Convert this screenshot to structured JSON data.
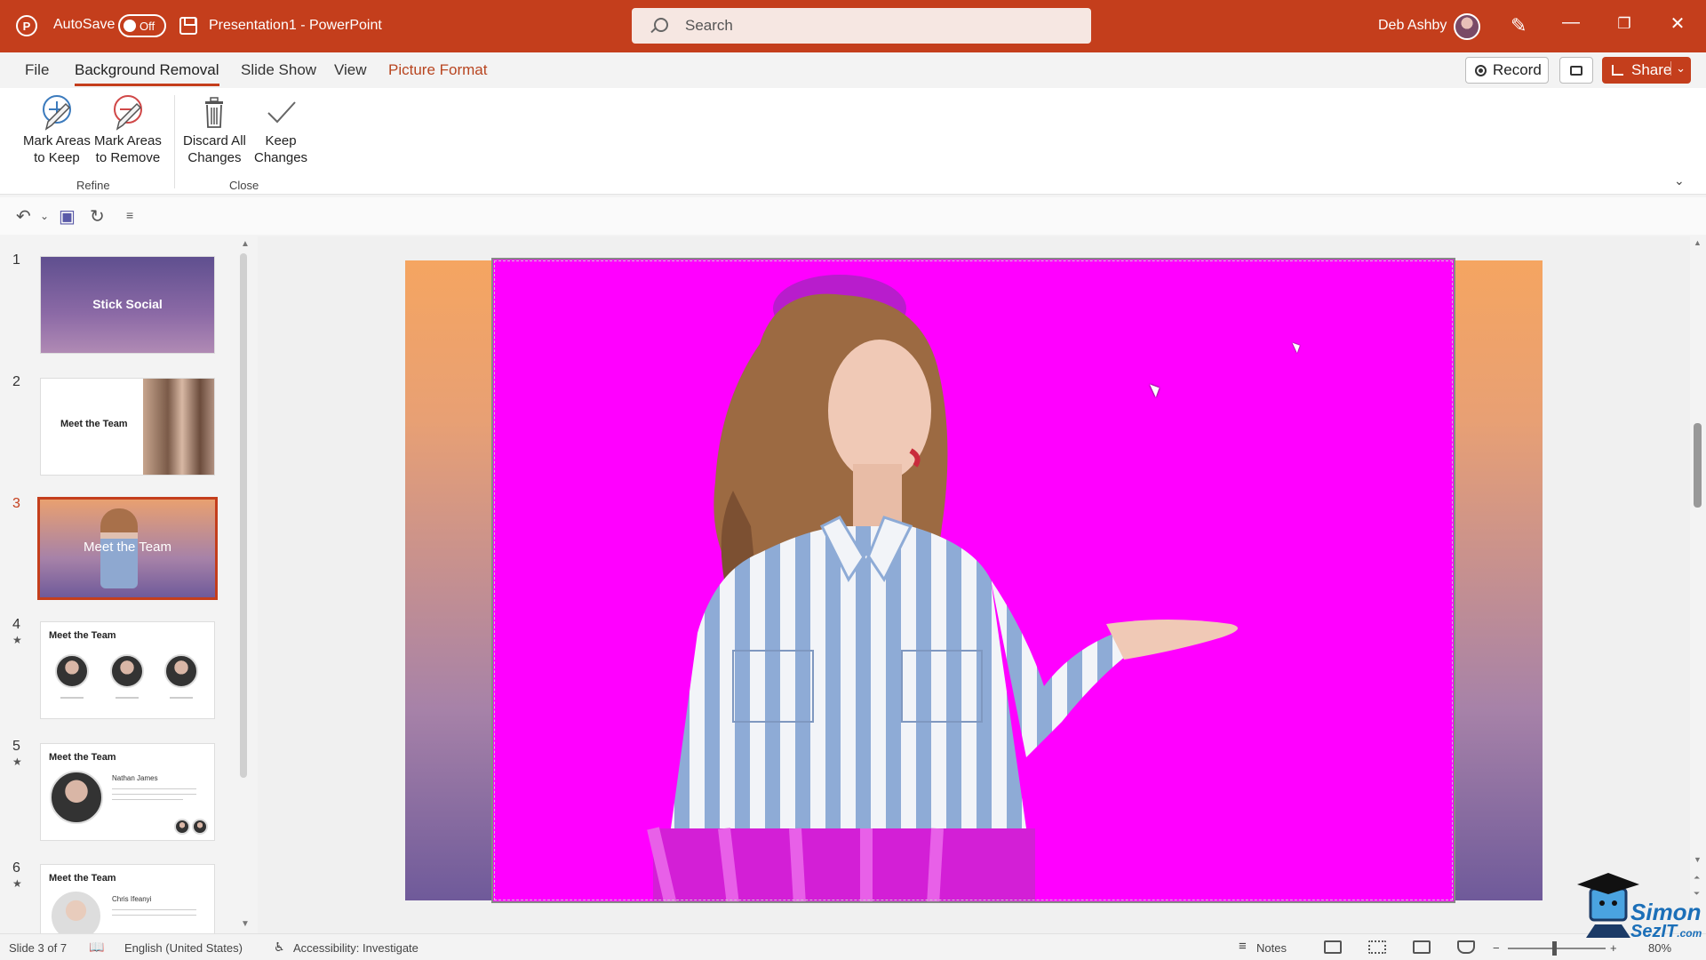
{
  "titlebar": {
    "app_icon": "powerpoint-logo-icon",
    "autosave_label": "AutoSave",
    "autosave_state": "Off",
    "document_name": "Presentation1",
    "separator": "-",
    "app_name": "PowerPoint",
    "search_placeholder": "Search",
    "user_name": "Deb Ashby",
    "window_controls": [
      "minimize-icon",
      "restore-icon",
      "close-icon"
    ]
  },
  "menu": {
    "tabs": [
      {
        "label": "File"
      },
      {
        "label": "Background Removal",
        "active": true
      },
      {
        "label": "Slide Show"
      },
      {
        "label": "View"
      },
      {
        "label": "Picture Format",
        "contextual": true
      }
    ],
    "record_label": "Record",
    "share_label": "Share"
  },
  "ribbon": {
    "buttons": [
      {
        "label_1": "Mark Areas",
        "label_2": "to Keep",
        "icon": "pencil-plus-icon"
      },
      {
        "label_1": "Mark Areas",
        "label_2": "to Remove",
        "icon": "pencil-minus-icon"
      },
      {
        "label_1": "Discard All",
        "label_2": "Changes",
        "icon": "trash-icon"
      },
      {
        "label_1": "Keep",
        "label_2": "Changes",
        "icon": "checkmark-icon"
      }
    ],
    "groups": [
      {
        "label": "Refine"
      },
      {
        "label": "Close"
      }
    ]
  },
  "slides": [
    {
      "number": "1",
      "title": "Stick Social"
    },
    {
      "number": "2",
      "title": "Meet the Team"
    },
    {
      "number": "3",
      "title": "Meet the Team",
      "selected": true
    },
    {
      "number": "4",
      "title": "Meet the Team",
      "animated": true
    },
    {
      "number": "5",
      "title": "Meet the Team",
      "animated": true,
      "subtitle": "Nathan James"
    },
    {
      "number": "6",
      "title": "Meet the Team",
      "animated": true,
      "subtitle": "Chris Ifeanyi"
    }
  ],
  "status": {
    "slide_info": "Slide 3 of 7",
    "language": "English (United States)",
    "accessibility": "Accessibility: Investigate",
    "notes_label": "Notes",
    "zoom": "80%"
  },
  "watermark": {
    "line1": "Simon",
    "line2": "SezIT",
    "suffix": ".com"
  },
  "colors": {
    "accent": "#c43e1c",
    "removal_overlay": "#ff00ff"
  }
}
